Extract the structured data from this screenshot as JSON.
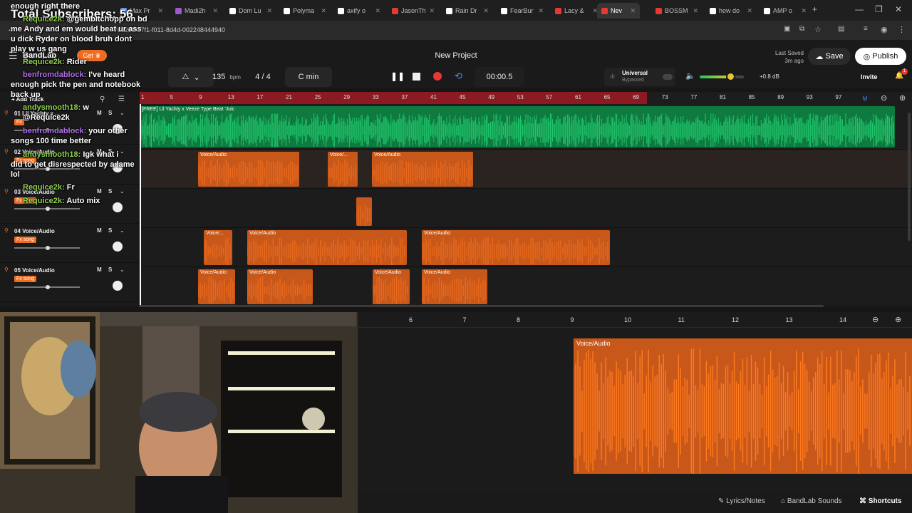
{
  "browser": {
    "tabs": [
      {
        "label": "Max Pr",
        "color": "#6aa7ff"
      },
      {
        "label": "Madi2h",
        "color": "#9b59d0"
      },
      {
        "label": "Dom Lu",
        "color": "#ffffff"
      },
      {
        "label": "Polyma",
        "color": "#ffffff"
      },
      {
        "label": "axify o",
        "color": "#ffffff"
      },
      {
        "label": "JasonTh",
        "color": "#e53935"
      },
      {
        "label": "Rain Dr",
        "color": "#ffffff"
      },
      {
        "label": "FearBur",
        "color": "#ffffff"
      },
      {
        "label": "Lacy &",
        "color": "#e53935"
      },
      {
        "label": "Nev",
        "color": "#e53935",
        "active": true
      },
      {
        "label": "BOSSM",
        "color": "#e53935"
      },
      {
        "label": "how do",
        "color": "#ffffff"
      },
      {
        "label": "AMP o",
        "color": "#ffffff"
      }
    ],
    "url": "7ca208-b7f1-f011-8d4d-002248444940"
  },
  "header": {
    "logo": "BandLab",
    "get_label": "Get",
    "project_title": "New Project",
    "last_saved_label": "Last Saved",
    "last_saved_time": "3m ago",
    "save_label": "Save",
    "publish_label": "Publish",
    "invite_label": "Invite",
    "notification_count": "1"
  },
  "transport": {
    "bpm_value": "135",
    "bpm_unit": "bpm",
    "time_signature": "4 / 4",
    "key": "C min",
    "time": "00:00.5",
    "master_preset": "Universal",
    "master_status": "Bypassed",
    "master_volume_db": "+0.8 dB",
    "master_volume_level": 0.7
  },
  "ruler": {
    "ticks": [
      "1",
      "5",
      "9",
      "13",
      "17",
      "21",
      "25",
      "29",
      "33",
      "37",
      "41",
      "45",
      "49",
      "53",
      "57",
      "61",
      "65",
      "69",
      "73",
      "77",
      "81",
      "85",
      "89",
      "93",
      "97"
    ],
    "loop_end_tick": "69"
  },
  "tracks": {
    "add_track_label": "Add Track",
    "items": [
      {
        "name": "01 Lil Yachty x ...",
        "fx": "Fx",
        "mute": "M",
        "solo": "S"
      },
      {
        "name": "02 Voice/Audio",
        "fx": "Fx song",
        "mute": "M",
        "solo": "S"
      },
      {
        "name": "03 Voice/Audio",
        "fx": "Fx song",
        "mute": "M",
        "solo": "S"
      },
      {
        "name": "04 Voice/Audio",
        "fx": "Fx song",
        "mute": "M",
        "solo": "S"
      },
      {
        "name": "05 Voice/Audio",
        "fx": "Fx song",
        "mute": "M",
        "solo": "S"
      }
    ]
  },
  "clips": {
    "beat_label": "[FREE] Lil Yachty x Veeze Type Beat 'Juic",
    "voice_label": "Voice/Audio",
    "voice_short_label": "Voice/..."
  },
  "lower_editor": {
    "ticks": [
      "6",
      "7",
      "8",
      "9",
      "10",
      "11",
      "12",
      "13",
      "14"
    ],
    "clip_label": "Voice/Audio"
  },
  "footer": {
    "lyrics_label": "Lyrics/Notes",
    "sounds_label": "BandLab Sounds",
    "shortcuts_label": "Shortcuts"
  },
  "stream_overlay": {
    "subscribers": "Total Subscribers: 56",
    "messages": [
      {
        "user": "",
        "text": "enough right there"
      },
      {
        "user": "Requice2k:",
        "text": "@gembitchopp on bd"
      },
      {
        "user": "",
        "text": "me Andy and em would beat ur ass"
      },
      {
        "user": "",
        "text": "u dick Ryder on blood bruh dont"
      },
      {
        "user": "",
        "text": "play w us gang"
      },
      {
        "user": "Requice2k:",
        "text": "Rider"
      },
      {
        "user": "benfromdablock:",
        "text": "I've heard"
      },
      {
        "user": "",
        "text": "enough pick the pen and notebook"
      },
      {
        "user": "",
        "text": "back up"
      },
      {
        "user": "andysmooth18:",
        "text": "w"
      },
      {
        "user": "",
        "text": "@Requice2k"
      },
      {
        "user": "benfromdablock:",
        "text": "your other"
      },
      {
        "user": "",
        "text": "songs 100 time better"
      },
      {
        "user": "andysmooth18:",
        "text": "Igk what i"
      },
      {
        "user": "",
        "text": "did to get disrespected by a lame"
      },
      {
        "user": "",
        "text": "lol"
      },
      {
        "user": "Requice2k:",
        "text": "Fr"
      },
      {
        "user": "Requice2k:",
        "text": "Auto mix"
      }
    ]
  },
  "colors": {
    "beat_clip": "#1fc46a",
    "voice_clip": "#e8691e",
    "loop_region": "#8c1a22",
    "record": "#e53935",
    "accent": "#ef6c20"
  }
}
